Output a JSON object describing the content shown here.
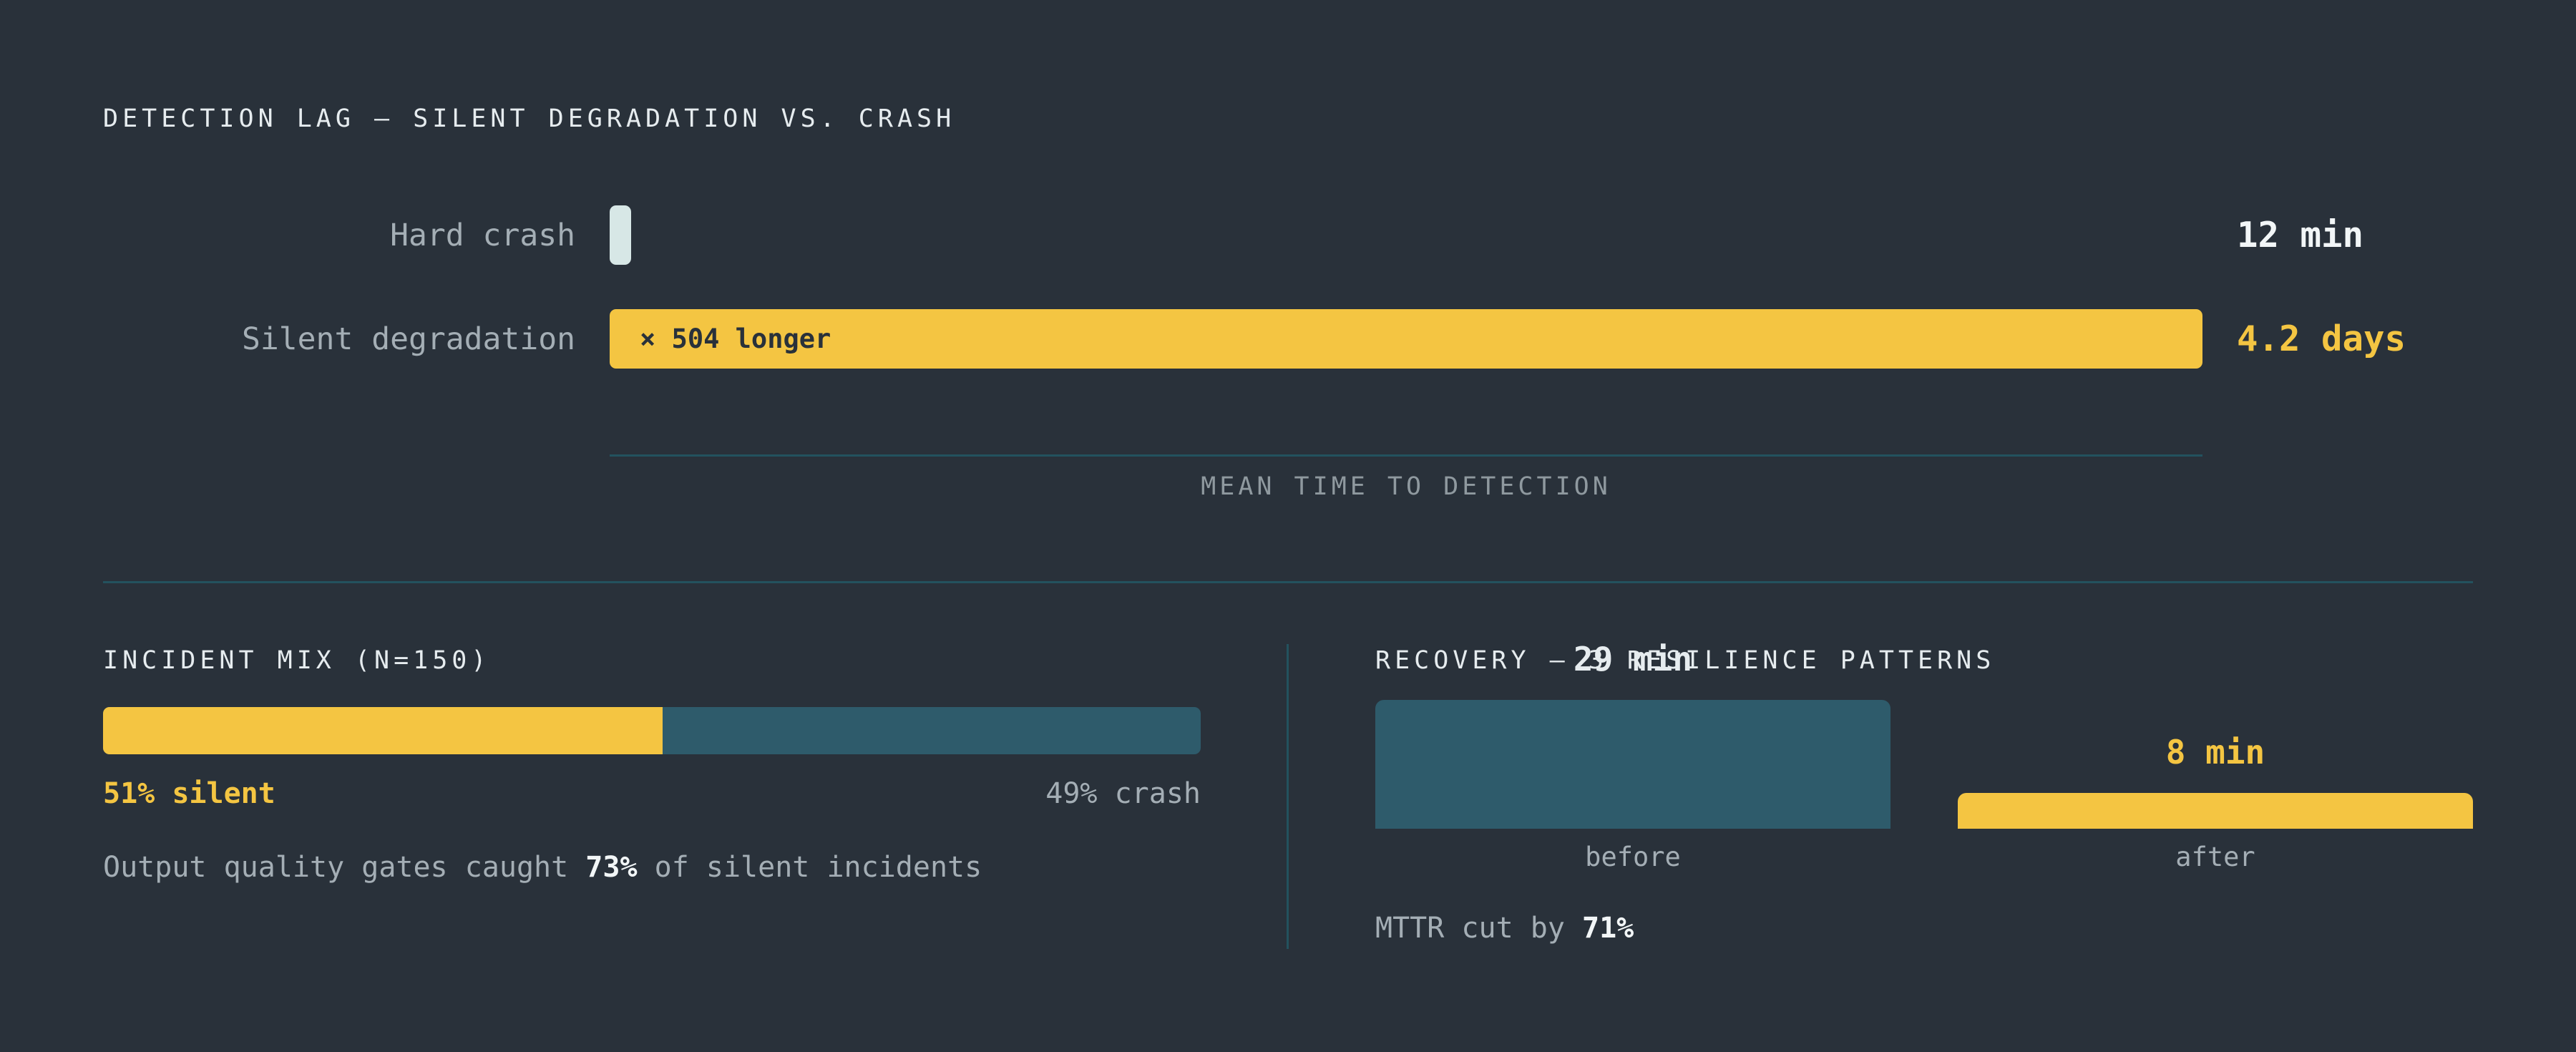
{
  "colors": {
    "background": "#29313a",
    "accent_yellow": "#f4c542",
    "crash_bar": "#d7e7e6",
    "teal_bar": "#2e5b6b",
    "rule": "#23525e",
    "muted_text": "#a4aeb5"
  },
  "chart_data": [
    {
      "type": "bar",
      "orientation": "horizontal",
      "title": "DETECTION LAG — SILENT DEGRADATION VS. CRASH",
      "xlabel": "MEAN TIME TO DETECTION",
      "categories": [
        "Hard crash",
        "Silent degradation"
      ],
      "values_minutes": [
        12,
        6048
      ],
      "value_labels": [
        "12 min",
        "4.2 days"
      ],
      "annotation": "× 504 longer",
      "grid": false
    },
    {
      "type": "bar",
      "orientation": "stacked-horizontal",
      "title": "INCIDENT MIX (N=150)",
      "segments": [
        {
          "name": "silent",
          "percent": 51,
          "label": "51% silent"
        },
        {
          "name": "crash",
          "percent": 49,
          "label": "49% crash"
        }
      ],
      "note": {
        "prefix": "Output quality gates caught ",
        "highlight": "73%",
        "suffix": " of silent incidents"
      }
    },
    {
      "type": "bar",
      "title": "RECOVERY — 3 RESILIENCE PATTERNS",
      "categories": [
        "before",
        "after"
      ],
      "values": [
        29,
        8
      ],
      "value_labels": [
        "29 min",
        "8 min"
      ],
      "unit": "min",
      "note": {
        "prefix": "MTTR cut by ",
        "highlight": "71%"
      }
    }
  ]
}
